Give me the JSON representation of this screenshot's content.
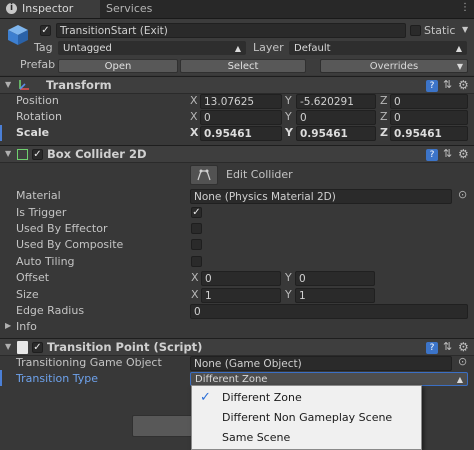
{
  "tabs": [
    {
      "label": "Inspector",
      "active": true
    },
    {
      "label": "Services",
      "active": false
    }
  ],
  "object": {
    "name": "TransitionStart (Exit)",
    "static_label": "Static",
    "tag_label": "Tag",
    "tag_value": "Untagged",
    "layer_label": "Layer",
    "layer_value": "Default",
    "prefab_label": "Prefab",
    "open_button": "Open",
    "select_button": "Select",
    "overrides_button": "Overrides"
  },
  "transform": {
    "title": "Transform",
    "position_label": "Position",
    "position": {
      "x": "13.07625",
      "y": "-5.620291",
      "z": "0"
    },
    "rotation_label": "Rotation",
    "rotation": {
      "x": "0",
      "y": "0",
      "z": "0"
    },
    "scale_label": "Scale",
    "scale": {
      "x": "0.95461",
      "y": "0.95461",
      "z": "0.95461"
    }
  },
  "box_collider": {
    "title": "Box Collider 2D",
    "edit_collider": "Edit Collider",
    "material_label": "Material",
    "material_value": "None (Physics Material 2D)",
    "is_trigger_label": "Is Trigger",
    "is_trigger": true,
    "used_by_effector_label": "Used By Effector",
    "used_by_composite_label": "Used By Composite",
    "auto_tiling_label": "Auto Tiling",
    "offset_label": "Offset",
    "offset": {
      "x": "0",
      "y": "0"
    },
    "size_label": "Size",
    "size": {
      "x": "1",
      "y": "1"
    },
    "edge_radius_label": "Edge Radius",
    "edge_radius": "0",
    "info_label": "Info"
  },
  "transition_point": {
    "title": "Transition Point (Script)",
    "transitioning_label": "Transitioning Game Object",
    "transitioning_value": "None (Game Object)",
    "type_label": "Transition Type",
    "type_value": "Different Zone"
  },
  "dropdown_options": [
    {
      "label": "Different Zone",
      "checked": true
    },
    {
      "label": "Different Non Gameplay Scene",
      "checked": false
    },
    {
      "label": "Same Scene",
      "checked": false
    }
  ],
  "axis_labels": {
    "x": "X",
    "y": "Y",
    "z": "Z"
  },
  "colors": {
    "accent_blue": "#4b7fd6",
    "check_blue": "#2b6fd8"
  }
}
